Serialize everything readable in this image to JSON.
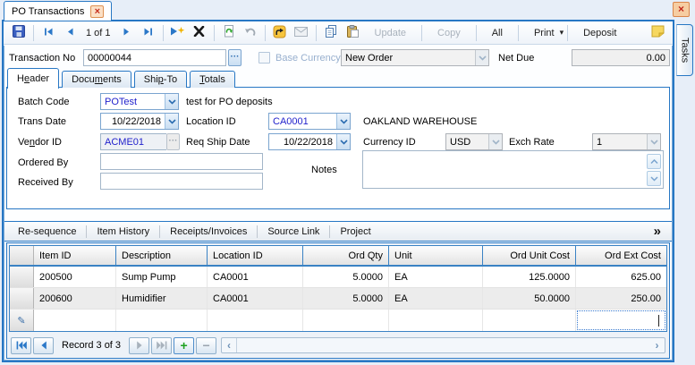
{
  "window": {
    "tab_title": "PO Transactions",
    "tasks_label": "Tasks"
  },
  "toolbar": {
    "record_position": "1 of 1",
    "update_label": "Update",
    "copy_label": "Copy",
    "all_label": "All",
    "print_label": "Print",
    "deposit_label": "Deposit"
  },
  "transaction": {
    "label": "Transaction No",
    "number": "00000044",
    "base_currency_label": "Base Currency",
    "type_value": "New Order",
    "net_due_label": "Net Due",
    "net_due_value": "0.00"
  },
  "tabs": [
    {
      "pre": "H",
      "u": "e",
      "post": "ader"
    },
    {
      "pre": "Docu",
      "u": "m",
      "post": "ents"
    },
    {
      "pre": "Shi",
      "u": "p",
      "post": "-To"
    },
    {
      "pre": "",
      "u": "T",
      "post": "otals"
    }
  ],
  "header": {
    "batch_code_label": "Batch Code",
    "batch_code_value": "POTest",
    "batch_desc": "test for PO deposits",
    "trans_date_label": "Trans Date",
    "trans_date_value": "10/22/2018",
    "location_label": "Location ID",
    "location_value": "CA0001",
    "location_desc": "OAKLAND WAREHOUSE",
    "vendor_label_pre": "Ve",
    "vendor_label_u": "n",
    "vendor_label_post": "dor ID",
    "vendor_value": "ACME01",
    "req_ship_label": "Req Ship Date",
    "req_ship_value": "10/22/2018",
    "currency_label": "Currency ID",
    "currency_value": "USD",
    "exch_rate_label": "Exch Rate",
    "exch_rate_value": "1",
    "ordered_by_label": "Ordered By",
    "ordered_by_value": "",
    "received_by_label": "Received By",
    "received_by_value": "",
    "notes_label": "Notes",
    "notes_value": ""
  },
  "detail_toolbar": {
    "buttons": [
      "Re-sequence",
      "Item History",
      "Receipts/Invoices",
      "Source Link",
      "Project"
    ],
    "overflow": "»"
  },
  "grid": {
    "columns": [
      "Item ID",
      "Description",
      "Location ID",
      "Ord Qty",
      "Unit",
      "Ord Unit Cost",
      "Ord Ext Cost"
    ],
    "rows": [
      {
        "item_id": "200500",
        "description": "Sump Pump",
        "location_id": "CA0001",
        "ord_qty": "5.0000",
        "unit": "EA",
        "ord_unit_cost": "125.0000",
        "ord_ext_cost": "625.00"
      },
      {
        "item_id": "200600",
        "description": "Humidifier",
        "location_id": "CA0001",
        "ord_qty": "5.0000",
        "unit": "EA",
        "ord_unit_cost": "50.0000",
        "ord_ext_cost": "250.00"
      }
    ]
  },
  "record_nav": {
    "label": "Record 3 of 3"
  }
}
